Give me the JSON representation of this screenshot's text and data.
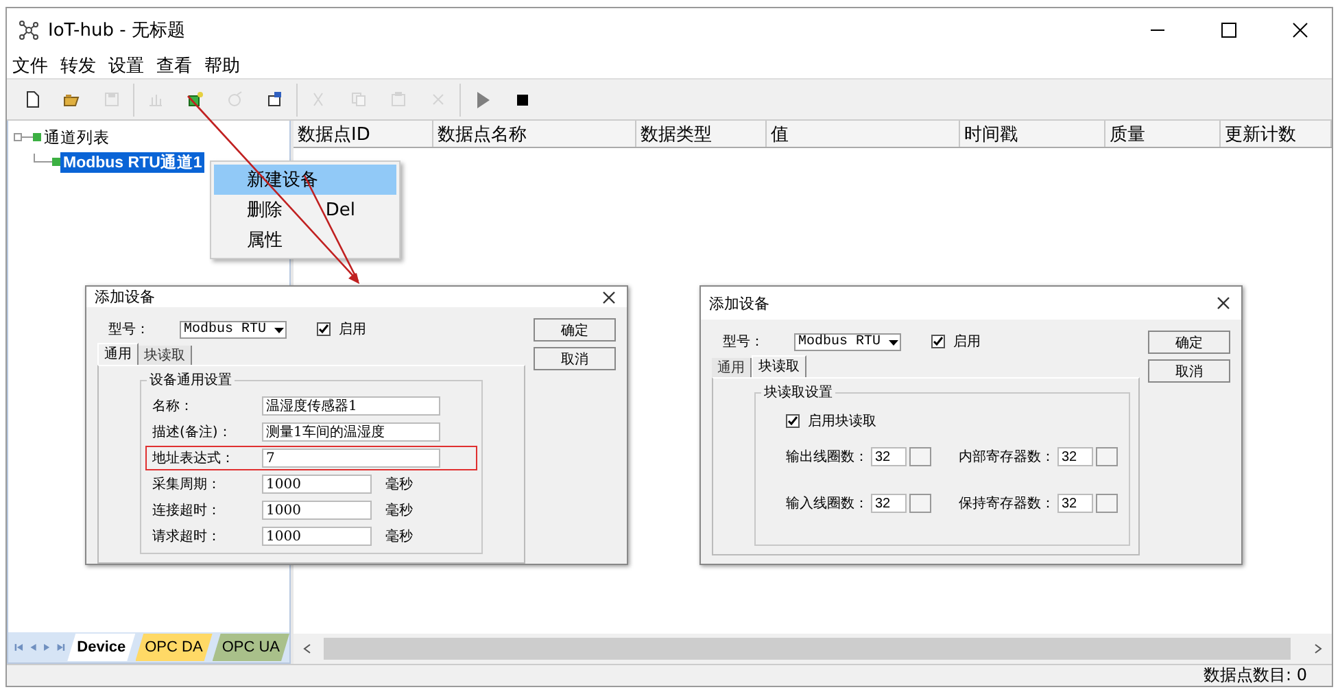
{
  "window": {
    "title": "IoT-hub - 无标题"
  },
  "menu": [
    "文件",
    "转发",
    "设置",
    "查看",
    "帮助"
  ],
  "toolbar": [
    {
      "disabled": false
    },
    {
      "disabled": false
    },
    {
      "disabled": true
    },
    {
      "disabled": true
    },
    {
      "disabled": false
    },
    {
      "disabled": true
    },
    {
      "disabled": false
    },
    {
      "disabled": true
    },
    {
      "disabled": true
    },
    {
      "disabled": true
    },
    {
      "disabled": true
    },
    {
      "disabled": false
    },
    {
      "disabled": false
    }
  ],
  "tree": {
    "label": "通道列表",
    "children": [
      {
        "label": "Modbus RTU通道1",
        "selected": true
      }
    ]
  },
  "context_menu": [
    {
      "label": "新建设备",
      "selected": true
    },
    {
      "label": "删除",
      "shortcut": "Del",
      "selected": false
    },
    {
      "label": "属性",
      "selected": false
    }
  ],
  "table": {
    "columns": [
      "数据点ID",
      "数据点名称",
      "数据类型",
      "值",
      "时间戳",
      "质量",
      "更新计数"
    ]
  },
  "sheet_tabs": [
    {
      "label": "Device",
      "selected": true,
      "color": "#ffffff"
    },
    {
      "label": "OPC DA",
      "selected": false,
      "color": "#ffd966"
    },
    {
      "label": "OPC UA",
      "selected": false,
      "color": "#a9c08a"
    }
  ],
  "status_bar": "数据点数目: 0",
  "dialogs": [
    {
      "kind": "general",
      "title": "添加设备",
      "model_label": "型号：",
      "model": "Modbus RTU",
      "enable": {
        "label": "启用",
        "checked": true
      },
      "buttons": [
        "确定",
        "取消"
      ],
      "tabs": [
        {
          "label": "通用",
          "selected": true
        },
        {
          "label": "块读取",
          "selected": false
        }
      ],
      "group": "设备通用设置",
      "fields": [
        {
          "label": "名称：",
          "value": "温湿度传感器1",
          "highlighted": false
        },
        {
          "label": "描述(备注)：",
          "value": "测量1车间的温湿度",
          "highlighted": false
        },
        {
          "label": "地址表达式：",
          "value": "7",
          "highlighted": true
        },
        {
          "label": "采集周期：",
          "value": "1000",
          "unit": "毫秒",
          "highlighted": false
        },
        {
          "label": "连接超时：",
          "value": "1000",
          "unit": "毫秒",
          "highlighted": false
        },
        {
          "label": "请求超时：",
          "value": "1000",
          "unit": "毫秒",
          "highlighted": false
        }
      ]
    },
    {
      "kind": "block",
      "title": "添加设备",
      "model_label": "型号：",
      "model": "Modbus RTU",
      "enable": {
        "label": "启用",
        "checked": true
      },
      "buttons": [
        "确定",
        "取消"
      ],
      "tabs": [
        {
          "label": "通用",
          "selected": false
        },
        {
          "label": "块读取",
          "selected": true
        }
      ],
      "group": "块读取设置",
      "block_enable": {
        "label": "启用块读取",
        "checked": true
      },
      "spinners": [
        {
          "label": "输出线圈数：",
          "value": "32"
        },
        {
          "label": "内部寄存器数：",
          "value": "32"
        },
        {
          "label": "输入线圈数：",
          "value": "32"
        },
        {
          "label": "保持寄存器数：",
          "value": "32"
        }
      ]
    }
  ]
}
